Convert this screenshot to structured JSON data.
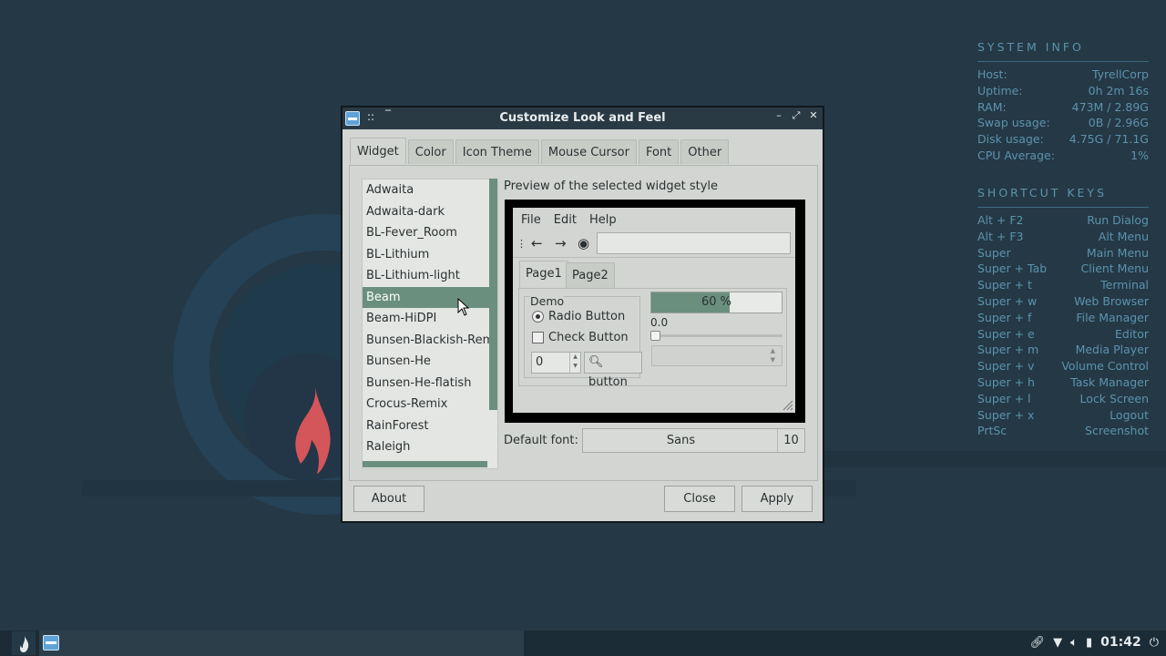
{
  "window": {
    "title": "Customize Look and Feel",
    "tabs": [
      "Widget",
      "Color",
      "Icon Theme",
      "Mouse Cursor",
      "Font",
      "Other"
    ],
    "active_tab": "Widget",
    "themes": [
      "Adwaita",
      "Adwaita-dark",
      "BL-Fever_Room",
      "BL-Lithium",
      "BL-Lithium-light",
      "Beam",
      "Beam-HiDPI",
      "Bunsen-Blackish-Remix",
      "Bunsen-He",
      "Bunsen-He-flatish",
      "Crocus-Remix",
      "RainForest",
      "Raleigh"
    ],
    "selected_theme": "Beam",
    "preview_label": "Preview of the selected widget style",
    "preview": {
      "menu": [
        "File",
        "Edit",
        "Help"
      ],
      "tabs": [
        "Page1",
        "Page2"
      ],
      "frame_label": "Demo",
      "radio_label": "Radio Button",
      "check_label": "Check Button",
      "spin_value": "0",
      "button_label": "button",
      "progress_text": "60 %",
      "progress_fraction": 0.6,
      "scale_value": "0.0"
    },
    "default_font_label": "Default font:",
    "font_name": "Sans",
    "font_size": "10",
    "buttons": {
      "about": "About",
      "close": "Close",
      "apply": "Apply"
    }
  },
  "conky": {
    "system_title": "SYSTEM INFO",
    "system": [
      [
        "Host:",
        "TyrellCorp"
      ],
      [
        "Uptime:",
        "0h 2m 16s"
      ],
      [
        "RAM:",
        "473M / 2.89G"
      ],
      [
        "Swap usage:",
        "0B / 2.96G"
      ],
      [
        "Disk usage:",
        "4.75G / 71.1G"
      ],
      [
        "CPU Average:",
        "1%"
      ]
    ],
    "shortcut_title": "SHORTCUT KEYS",
    "shortcuts": [
      [
        "Alt + F2",
        "Run Dialog"
      ],
      [
        "Alt + F3",
        "Alt Menu"
      ],
      [
        "Super",
        "Main Menu"
      ],
      [
        "Super + Tab",
        "Client Menu"
      ],
      [
        "Super + t",
        "Terminal"
      ],
      [
        "Super + w",
        "Web Browser"
      ],
      [
        "Super + f",
        "File Manager"
      ],
      [
        "Super + e",
        "Editor"
      ],
      [
        "Super + m",
        "Media Player"
      ],
      [
        "Super + v",
        "Volume Control"
      ],
      [
        "Super + h",
        "Task Manager"
      ],
      [
        "Super + l",
        "Lock Screen"
      ],
      [
        "Super + x",
        "Logout"
      ],
      [
        "PrtSc",
        "Screenshot"
      ]
    ]
  },
  "taskbar": {
    "clock": "01:42"
  },
  "colors": {
    "accent": "#6a8f7f",
    "desktop": "#253845",
    "conky_text": "#5b93ad",
    "flame": "#d4555a"
  }
}
